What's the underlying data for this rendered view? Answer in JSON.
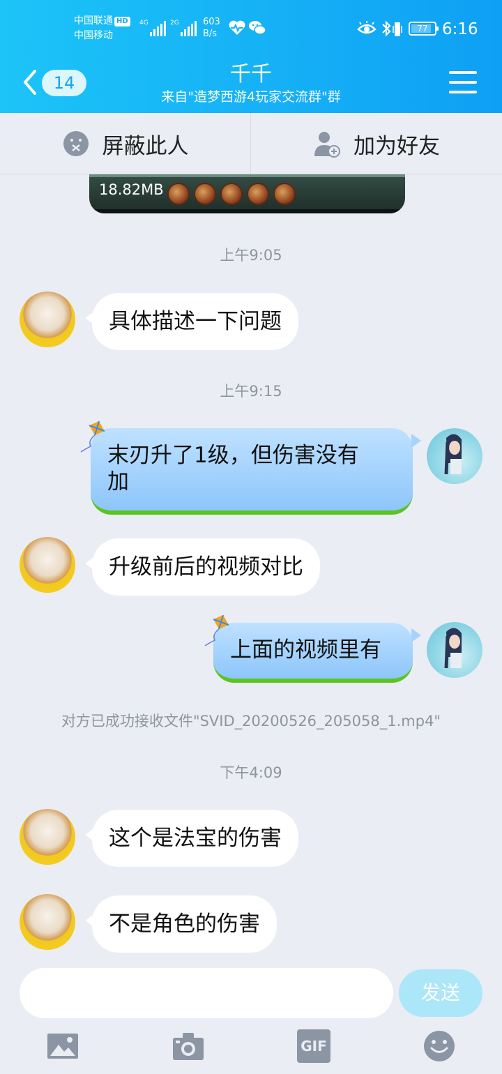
{
  "status_bar": {
    "carrier_1": "中国联通",
    "hd_badge": "HD",
    "carrier_2": "中国移动",
    "net_1": "4G",
    "net_2": "2G",
    "speed_value": "603",
    "speed_unit": "B/s",
    "battery_level": "77",
    "time": "6:16"
  },
  "header": {
    "unread_count": "14",
    "title": "千千",
    "subtitle": "来自\"造梦西游4玩家交流群\"群"
  },
  "actions": {
    "block_label": "屏蔽此人",
    "add_friend_label": "加为好友"
  },
  "video": {
    "size": "18.82MB"
  },
  "messages": {
    "time_1": "上午9:05",
    "msg_1": "具体描述一下问题",
    "time_2": "上午9:15",
    "msg_2_line1": "末刃升了1级，但伤害没有",
    "msg_2_line2": "加",
    "msg_3": "升级前后的视频对比",
    "msg_4": "上面的视频里有",
    "system_file": "对方已成功接收文件\"SVID_20200526_205058_1.mp4\"",
    "time_3": "下午4:09",
    "msg_5": "这个是法宝的伤害",
    "msg_6": "不是角色的伤害"
  },
  "input": {
    "placeholder": "",
    "send_label": "发送"
  },
  "toolbar": {
    "gif_label": "GIF"
  },
  "colors": {
    "header_blue": "#16b2f6",
    "background": "#eaedf4",
    "send_button": "#ace6f9",
    "bubble_out": "#8dc6fb"
  }
}
